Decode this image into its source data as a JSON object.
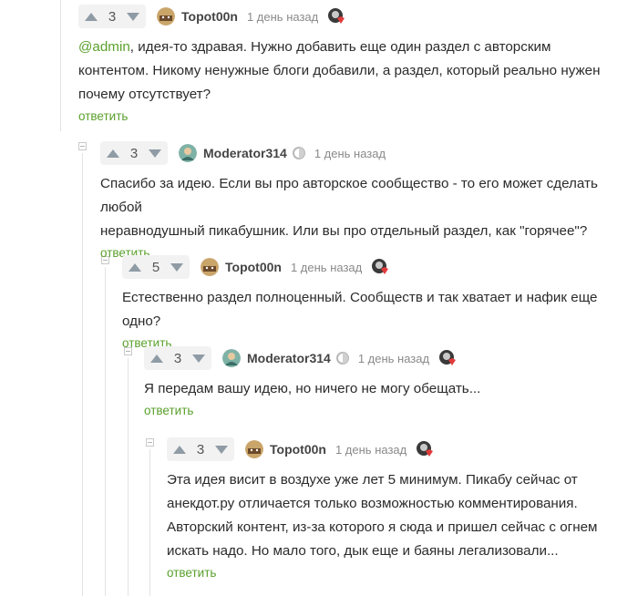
{
  "reply_label": "ответить",
  "comments": [
    {
      "rating": "3",
      "author": "Topot00n",
      "time": "1 день назад",
      "mention": "@admin",
      "lines": [
        ", идея-то здравая. Нужно добавить еще один раздел с авторским",
        "контентом. Никому ненужные блоги добавили, а раздел, который реально нужен",
        "почему отсутствует?"
      ]
    },
    {
      "rating": "3",
      "author": "Moderator314",
      "time": "1 день назад",
      "lines": [
        "Спасибо за идею. Если вы про авторское сообщество - то его может сделать любой",
        "неравнодушный пикабушник. Или вы про отдельный раздел, как \"горячее\"?"
      ]
    },
    {
      "rating": "5",
      "author": "Topot00n",
      "time": "1 день назад",
      "lines": [
        "Естественно раздел полноценный. Сообществ и так хватает и нафик еще одно?"
      ]
    },
    {
      "rating": "3",
      "author": "Moderator314",
      "time": "1 день назад",
      "lines": [
        "Я передам вашу идею, но ничего не могу обещать..."
      ]
    },
    {
      "rating": "3",
      "author": "Topot00n",
      "time": "1 день назад",
      "lines": [
        "Эта идея висит в воздухе уже лет 5 минимум. Пикабу сейчас от",
        "анекдот.ру отличается только возможностью комментирования.",
        "Авторский контент, из-за которого я сюда и пришел сейчас с огнем",
        "искать надо. Но мало того, дык еще и баяны легализовали..."
      ]
    }
  ],
  "colors": {
    "reply": "#5aa02c",
    "mention": "#5aa02c",
    "vote_arrow": "#8f9ba5"
  }
}
